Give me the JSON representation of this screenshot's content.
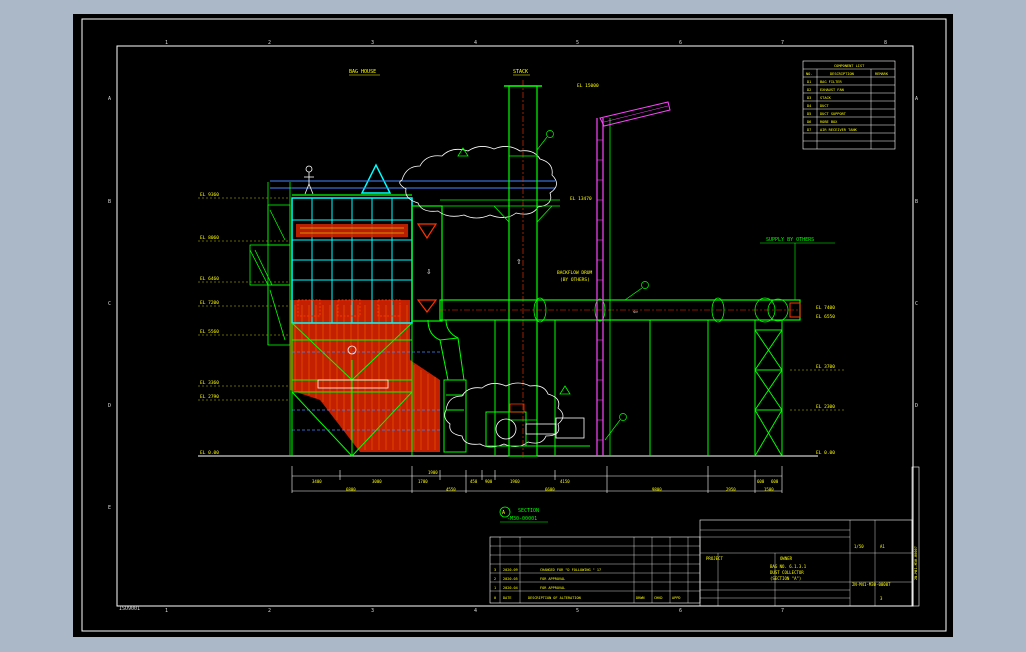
{
  "titles": {
    "bag_house": "BAG HOUSE",
    "stack": "STACK",
    "section_circle": "A",
    "section_title": "SECTION",
    "section_ref": "-M30-00001",
    "supply_by_others": "SUPPLY BY OTHERS",
    "duct_note_1": "BACKFLOW DRUM",
    "duct_note_2": "(BY OTHERS)",
    "stack_top_el": "EL 15000",
    "stack_el_2": "EL 13470"
  },
  "left_levels": [
    "EL 9360",
    "EL 8060",
    "EL 6460",
    "EL 7200",
    "EL 5560",
    "EL 3360",
    "EL 2790",
    "EL 0.00"
  ],
  "right_levels": [
    "EL 7400",
    "EL 6550",
    "EL 3700",
    "EL 2300",
    "EL 0.00"
  ],
  "bottom_dims_row1": [
    "3400",
    "3000",
    "1700",
    "1900",
    "450",
    "900",
    "1960",
    "4150",
    "600",
    "600"
  ],
  "bottom_dims_row2": [
    "6800",
    "4550",
    "6600",
    "9800",
    "2950",
    "1500"
  ],
  "component_table": {
    "title": "COMPONENT LIST",
    "headers": [
      "NO.",
      "DESCRIPTION",
      "REMARK"
    ],
    "rows": [
      [
        "D1",
        "BAG FILTER",
        ""
      ],
      [
        "D2",
        "EXHAUST FAN",
        ""
      ],
      [
        "D3",
        "STACK",
        ""
      ],
      [
        "D4",
        "DUCT",
        ""
      ],
      [
        "D5",
        "DUCT SUPPORT",
        ""
      ],
      [
        "D6",
        "ROBE BOX",
        ""
      ],
      [
        "D7",
        "AIR RECEIVER TANK",
        ""
      ]
    ]
  },
  "revision_table": {
    "rows": [
      [
        "",
        "",
        "",
        "",
        "",
        ""
      ],
      [
        "",
        "",
        "",
        "",
        "",
        ""
      ],
      [
        "",
        "",
        "",
        "",
        "",
        ""
      ],
      [
        "3",
        "2020.09",
        "CHANGED FOR \"D FOLLOWING \" 17",
        "",
        "",
        ""
      ],
      [
        "2",
        "2020.05",
        "FOR APPROVAL",
        "",
        "",
        ""
      ],
      [
        "1",
        "2020.04",
        "FOR APPROVAL",
        "",
        "",
        ""
      ],
      [
        "0",
        "DATE",
        "DESCRIPTION OF ALTERATION",
        "DRWN",
        "CHKD",
        "APPD"
      ]
    ]
  },
  "title_block": {
    "project": "PROJECT",
    "owner": "OWNER",
    "scale": "1/50",
    "drawing_title_1": "BAG NO. 6.1.3.1",
    "drawing_title_2": "DUST COLLECTOR",
    "drawing_title_3": "(SECTION \"A\")",
    "drawing_no": "2N-M41-M30-00007",
    "side_no": "2N-M41-M30-00007",
    "rev": "3",
    "size": "A1"
  },
  "border": {
    "col_numbers": [
      "1",
      "2",
      "3",
      "4",
      "5",
      "6",
      "7",
      "8"
    ],
    "row_letters": [
      "A",
      "B",
      "C",
      "D",
      "E"
    ],
    "corner_note": "ISO9001"
  }
}
